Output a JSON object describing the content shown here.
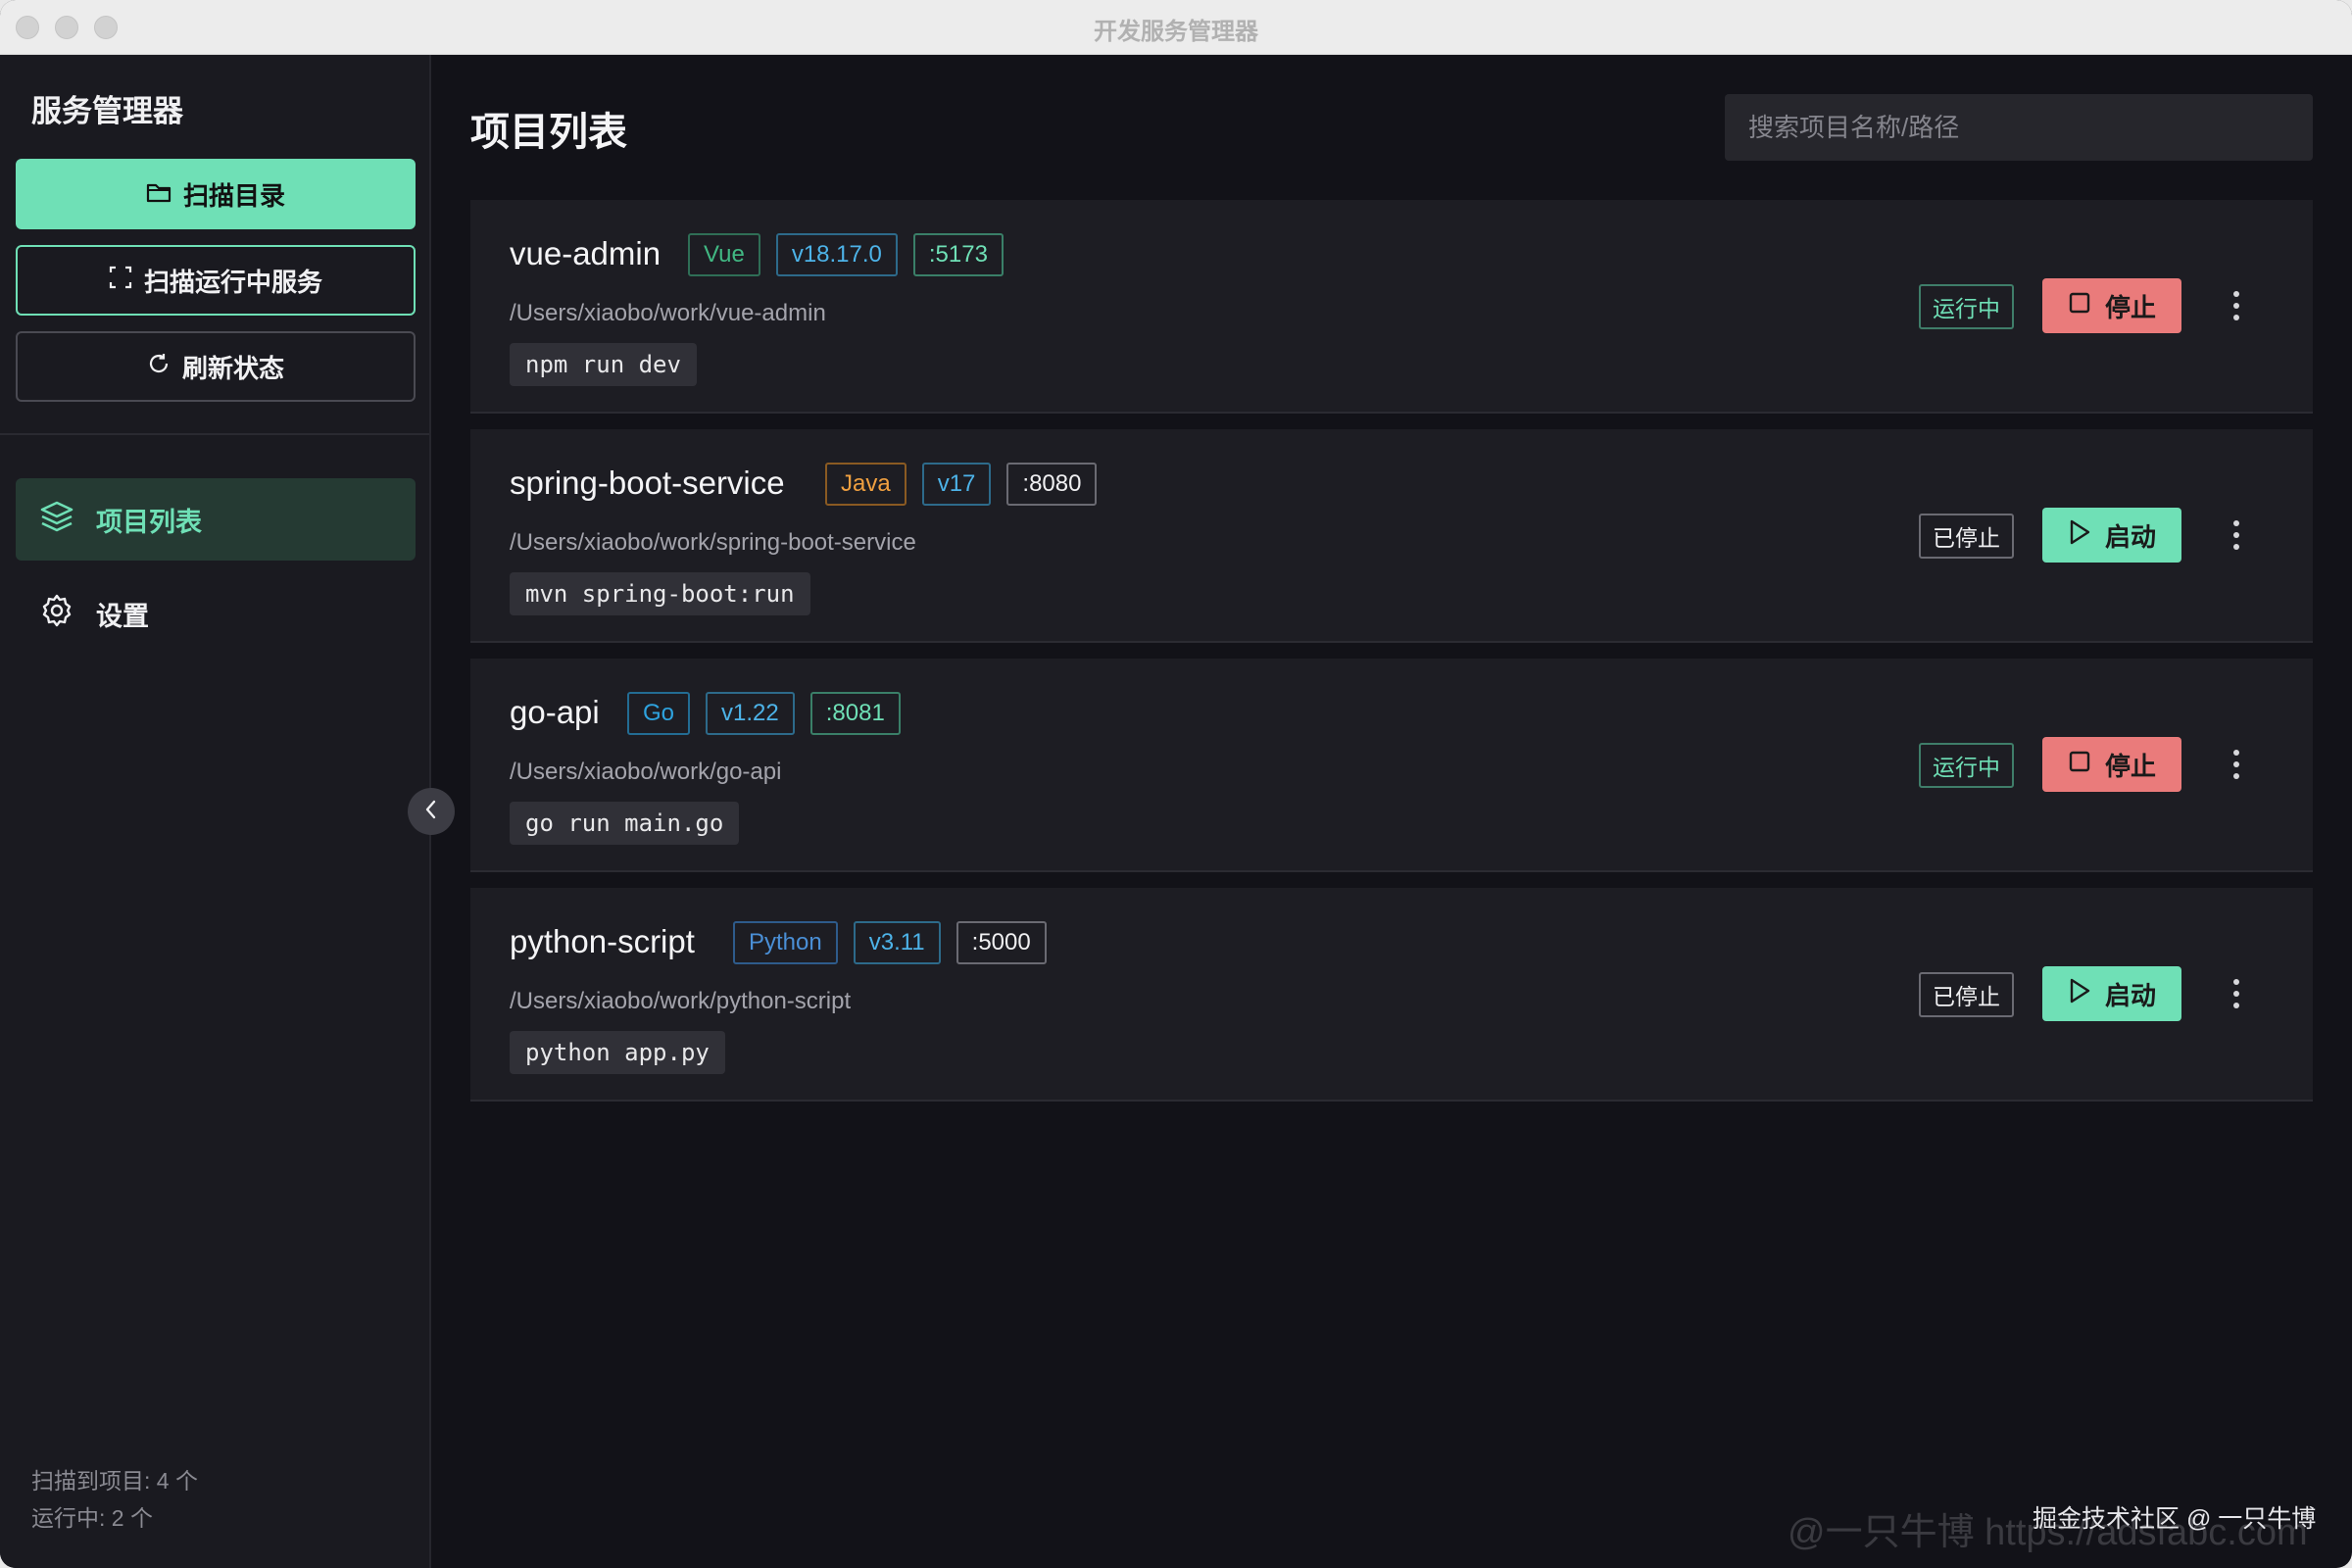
{
  "window": {
    "title": "开发服务管理器"
  },
  "sidebar": {
    "app_title": "服务管理器",
    "buttons": {
      "scan_dir": "扫描目录",
      "scan_running": "扫描运行中服务",
      "refresh": "刷新状态"
    },
    "nav": [
      {
        "label": "项目列表",
        "icon": "layers-icon",
        "active": true
      },
      {
        "label": "设置",
        "icon": "gear-icon",
        "active": false
      }
    ],
    "footer": {
      "scanned": "扫描到项目: 4 个",
      "running": "运行中: 2 个"
    }
  },
  "main": {
    "title": "项目列表",
    "search": {
      "placeholder": "搜索项目名称/路径",
      "value": ""
    },
    "projects": [
      {
        "name": "vue-admin",
        "lang": "Vue",
        "version": "v18.17.0",
        "port": ":5173",
        "path": "/Users/xiaobo/work/vue-admin",
        "command": "npm run dev",
        "status": "运行中",
        "action": "停止"
      },
      {
        "name": "spring-boot-service",
        "lang": "Java",
        "version": "v17",
        "port": ":8080",
        "path": "/Users/xiaobo/work/spring-boot-service",
        "command": "mvn spring-boot:run",
        "status": "已停止",
        "action": "启动"
      },
      {
        "name": "go-api",
        "lang": "Go",
        "version": "v1.22",
        "port": ":8081",
        "path": "/Users/xiaobo/work/go-api",
        "command": "go run main.go",
        "status": "运行中",
        "action": "停止"
      },
      {
        "name": "python-script",
        "lang": "Python",
        "version": "v3.11",
        "port": ":5000",
        "path": "/Users/xiaobo/work/python-script",
        "command": "python app.py",
        "status": "已停止",
        "action": "启动"
      }
    ]
  },
  "watermark": {
    "text": "掘金技术社区 @ 一只牛博",
    "faint": "@一只牛博 https://adsfabc.com"
  },
  "colors": {
    "accent": "#6fe0b6",
    "danger": "#ea7b7b",
    "bg": "#121218",
    "sidebar": "#1a1a20",
    "card": "#1d1d23"
  }
}
